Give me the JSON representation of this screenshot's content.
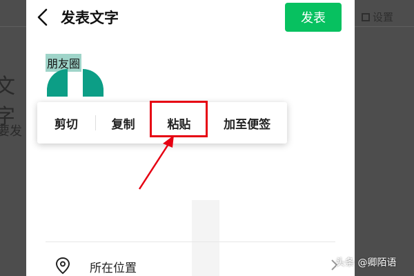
{
  "header": {
    "title": "发表文字",
    "publish_label": "发表"
  },
  "editor": {
    "selected_text": "朋友圈"
  },
  "context_menu": {
    "items": [
      {
        "label": "剪切"
      },
      {
        "label": "复制"
      },
      {
        "label": "粘贴"
      },
      {
        "label": "加至便签"
      }
    ]
  },
  "location": {
    "label": "所在位置"
  },
  "background": {
    "settings_label": "设置",
    "text_a": "文字",
    "text_b": "要发"
  },
  "watermark": "头条 @卿陌语",
  "colors": {
    "accent": "#07c160",
    "selection": "#9fd4c9",
    "handle": "#0c9e86",
    "annotation": "#e60012"
  },
  "icons": [
    "back-arrow-icon",
    "location-pin-icon",
    "chevron-right-icon"
  ]
}
